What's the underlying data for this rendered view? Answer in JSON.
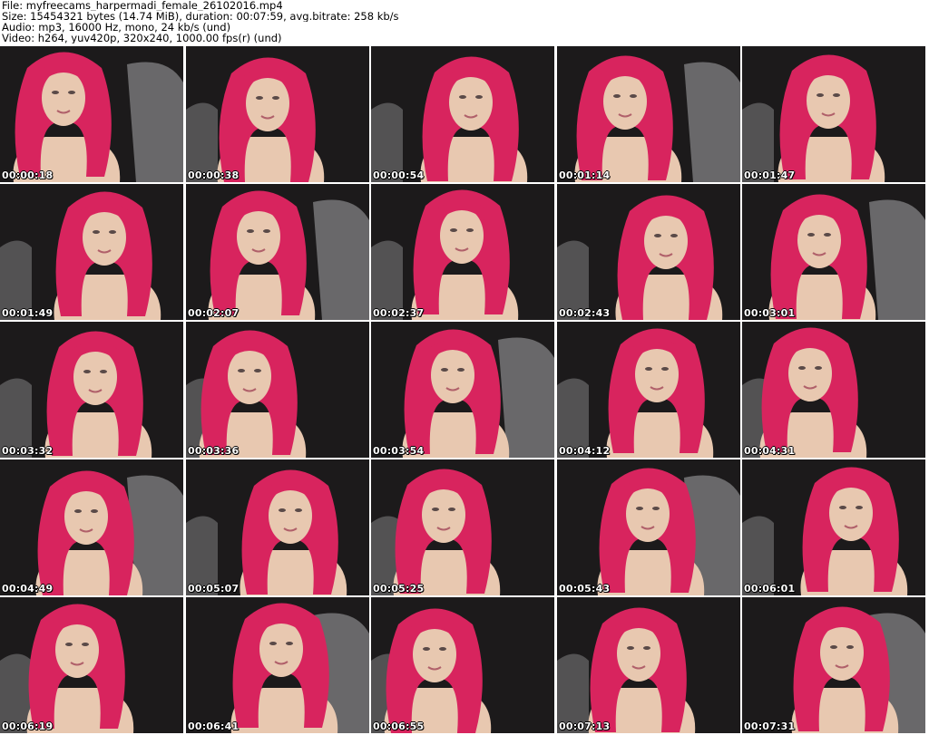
{
  "header": {
    "file_line": "File: myfreecams_harpermadi_female_26102016.mp4",
    "size_line": "Size: 15454321 bytes (14.74 MiB), duration: 00:07:59, avg.bitrate: 258 kb/s",
    "audio_line": "Audio: mp3, 16000 Hz, mono, 24 kb/s (und)",
    "video_line": "Video: h264, yuv420p, 320x240, 1000.00 fps(r) (und)"
  },
  "colors": {
    "hair": "#d8245e",
    "skin": "#e8c8b0",
    "background_dark": "#1c1a1b",
    "background_grey": "#8a8a8c"
  },
  "thumbnails": [
    {
      "timestamp": "00:00:18"
    },
    {
      "timestamp": "00:00:38"
    },
    {
      "timestamp": "00:00:54"
    },
    {
      "timestamp": "00:01:14"
    },
    {
      "timestamp": "00:01:47"
    },
    {
      "timestamp": "00:01:49"
    },
    {
      "timestamp": "00:02:07"
    },
    {
      "timestamp": "00:02:37"
    },
    {
      "timestamp": "00:02:43"
    },
    {
      "timestamp": "00:03:01"
    },
    {
      "timestamp": "00:03:32"
    },
    {
      "timestamp": "00:03:36"
    },
    {
      "timestamp": "00:03:54"
    },
    {
      "timestamp": "00:04:12"
    },
    {
      "timestamp": "00:04:31"
    },
    {
      "timestamp": "00:04:49"
    },
    {
      "timestamp": "00:05:07"
    },
    {
      "timestamp": "00:05:25"
    },
    {
      "timestamp": "00:05:43"
    },
    {
      "timestamp": "00:06:01"
    },
    {
      "timestamp": "00:06:19"
    },
    {
      "timestamp": "00:06:41"
    },
    {
      "timestamp": "00:06:55"
    },
    {
      "timestamp": "00:07:13"
    },
    {
      "timestamp": "00:07:31"
    }
  ]
}
